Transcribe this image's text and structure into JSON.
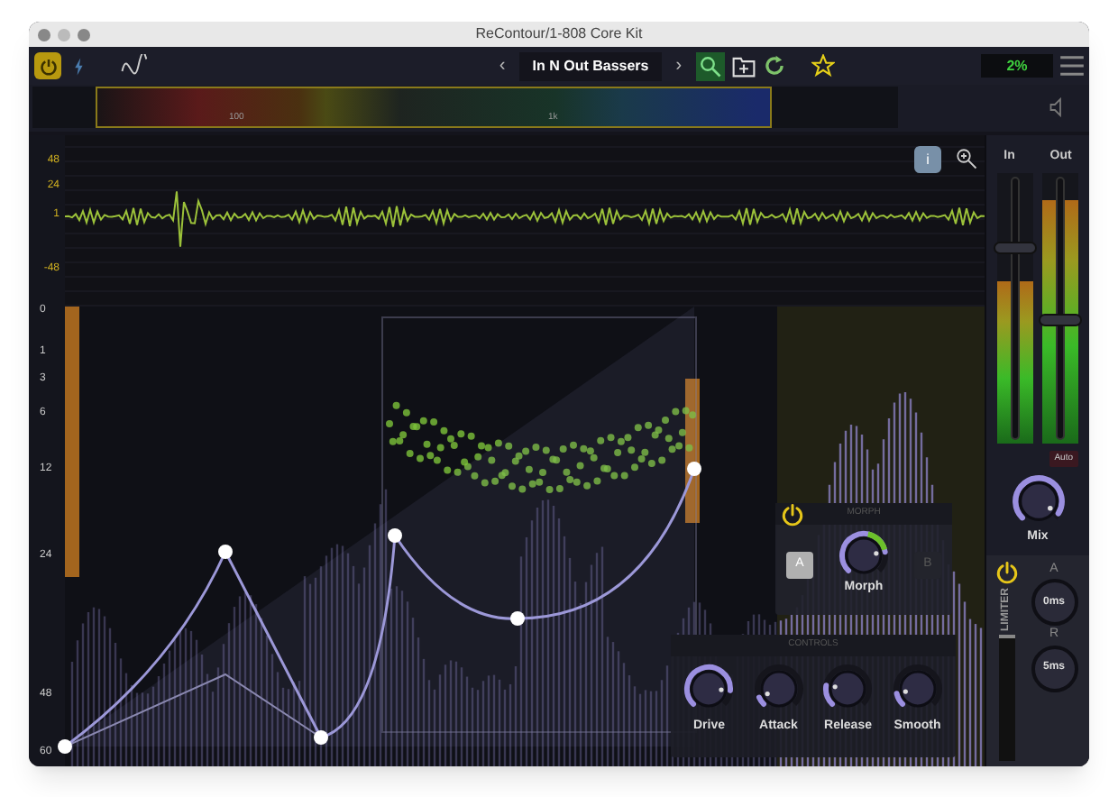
{
  "window": {
    "title": "ReContour/1-808 Core Kit"
  },
  "toolbar": {
    "power_on": true,
    "prev": "‹",
    "preset": "In N Out Bassers",
    "next": "›",
    "cpu": "2%"
  },
  "frequency_strip": {
    "labels": [
      "100",
      "1k"
    ]
  },
  "waveform": {
    "info": "i",
    "axis": [
      "48",
      "24",
      "1",
      "-48"
    ]
  },
  "spectrum": {
    "axis": [
      "0",
      "1",
      "3",
      "6",
      "12",
      "24",
      "48",
      "60"
    ]
  },
  "morph": {
    "title": "MORPH",
    "on": true,
    "buttons": [
      {
        "label": "A",
        "selected": true
      },
      {
        "label": "B",
        "selected": false
      }
    ],
    "knob": {
      "label": "Morph",
      "level": 0.8
    }
  },
  "controls": {
    "title": "CONTROLS",
    "knobs": [
      {
        "label": "Drive",
        "level": 0.85
      },
      {
        "label": "Attack",
        "level": 0.08
      },
      {
        "label": "Release",
        "level": 0.2
      },
      {
        "label": "Smooth",
        "level": 0.12
      }
    ]
  },
  "meters": [
    {
      "label": "In",
      "meter": {
        "level": 0.6
      },
      "fader": {
        "level": 0.72
      }
    },
    {
      "label": "Out",
      "meter": {
        "level": 0.9
      },
      "fader": {
        "level": 0.45
      }
    }
  ],
  "auto": {
    "label": "Auto"
  },
  "mix": {
    "label": "Mix",
    "level": 0.95
  },
  "limiter": {
    "title": "LIMITER",
    "on": true,
    "attack": {
      "label": "A",
      "value": "0ms"
    },
    "release": {
      "label": "R",
      "value": "5ms"
    }
  }
}
